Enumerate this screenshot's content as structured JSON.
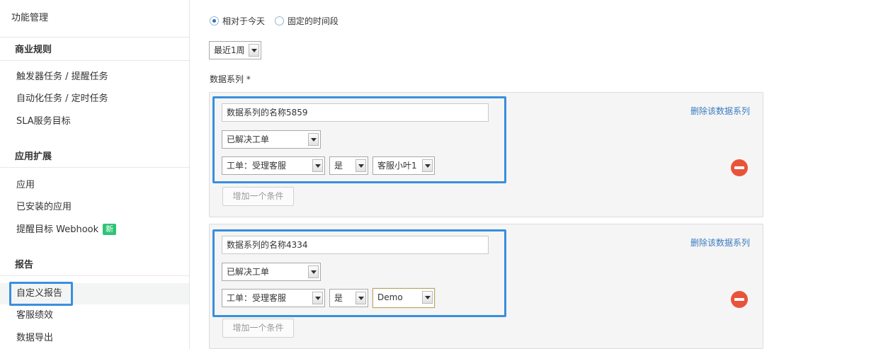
{
  "sidebar": {
    "top_title": "功能管理",
    "sections": [
      {
        "title": "商业规则",
        "items": [
          "触发器任务 / 提醒任务",
          "自动化任务 / 定时任务",
          "SLA服务目标"
        ]
      },
      {
        "title": "应用扩展",
        "items": [
          "应用",
          "已安装的应用",
          "提醒目标 Webhook"
        ],
        "badge": "新"
      },
      {
        "title": "报告",
        "items": [
          "自定义报告",
          "客服绩效",
          "数据导出"
        ]
      }
    ]
  },
  "main": {
    "radio_relative": "相对于今天",
    "radio_fixed": "固定的时间段",
    "range_select": "最近1周",
    "series_label": "数据系列 *",
    "series": [
      {
        "name": "数据系列的名称5859",
        "type": "已解决工单",
        "cond_field": "工单：受理客服",
        "cond_op": "是",
        "cond_value": "客服小叶1",
        "delete_label": "删除该数据系列",
        "add_condition": "增加一个条件"
      },
      {
        "name": "数据系列的名称4334",
        "type": "已解决工单",
        "cond_field": "工单：受理客服",
        "cond_op": "是",
        "cond_value": "Demo",
        "delete_label": "删除该数据系列",
        "add_condition": "增加一个条件"
      }
    ]
  },
  "colors": {
    "highlight": "#3a8fde",
    "delete_button": "#e9533a",
    "new_badge": "#2ec474",
    "link": "#3a7cc0"
  }
}
